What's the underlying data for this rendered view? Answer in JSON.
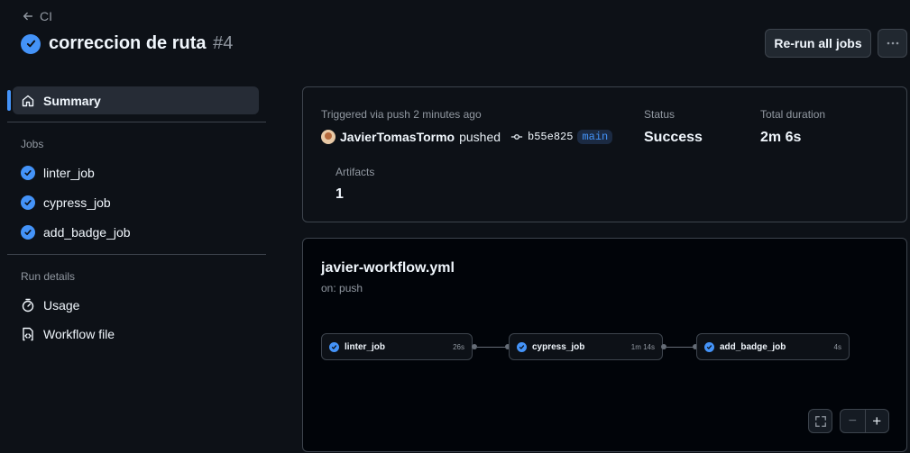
{
  "header": {
    "back_label": "CI",
    "title": "correccion de ruta",
    "run_number": "#4",
    "rerun_label": "Re-run all jobs"
  },
  "sidebar": {
    "summary_label": "Summary",
    "jobs_heading": "Jobs",
    "jobs": [
      {
        "label": "linter_job"
      },
      {
        "label": "cypress_job"
      },
      {
        "label": "add_badge_job"
      }
    ],
    "run_details_heading": "Run details",
    "usage_label": "Usage",
    "workflow_file_label": "Workflow file"
  },
  "summary_card": {
    "trigger_text": "Triggered via push 2 minutes ago",
    "actor": "JavierTomasTormo",
    "action": "pushed",
    "commit_sha": "b55e825",
    "branch": "main",
    "status_label": "Status",
    "status_value": "Success",
    "duration_label": "Total duration",
    "duration_value": "2m 6s",
    "artifacts_label": "Artifacts",
    "artifacts_value": "1"
  },
  "workflow_graph": {
    "file_name": "javier-workflow.yml",
    "trigger": "on: push",
    "jobs": [
      {
        "name": "linter_job",
        "duration": "26s"
      },
      {
        "name": "cypress_job",
        "duration": "1m 14s"
      },
      {
        "name": "add_badge_job",
        "duration": "4s"
      }
    ],
    "zoom_out_glyph": "−",
    "zoom_in_glyph": "+"
  },
  "colors": {
    "accent": "#4493f8",
    "background": "#0d1117",
    "border": "#3d444d"
  }
}
